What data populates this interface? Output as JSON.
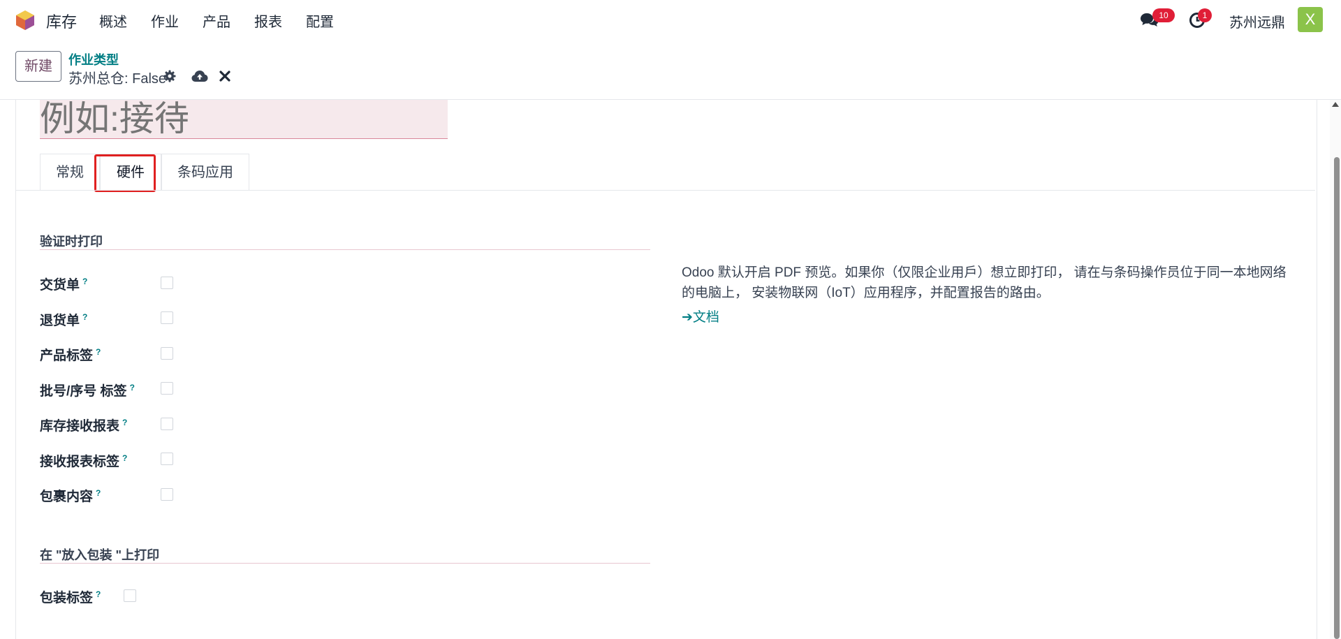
{
  "navbar": {
    "app_name": "库存",
    "menu": [
      "概述",
      "作业",
      "产品",
      "报表",
      "配置"
    ],
    "messages_badge": "10",
    "activities_badge": "1",
    "company": "苏州远鼎",
    "avatar_letter": "X",
    "icons": {
      "logo": "odoo-app-icon",
      "messages": "chat-icon",
      "activities": "clock-icon"
    }
  },
  "control": {
    "new_button": "新建",
    "breadcrumb": "作业类型",
    "record_name": "苏州总仓: False",
    "icons": {
      "settings": "gear-icon",
      "save": "cloud-upload-icon",
      "discard": "close-icon"
    }
  },
  "form": {
    "name_placeholder": "例如:接待",
    "tabs": [
      "常规",
      "硬件",
      "条码应用"
    ],
    "active_tab": "硬件",
    "section_print_on_validation": "验证时打印",
    "fields": [
      {
        "label": "交货单",
        "help": "?",
        "checked": false
      },
      {
        "label": "退货单",
        "help": "?",
        "checked": false
      },
      {
        "label": "产品标签",
        "help": "?",
        "checked": false
      },
      {
        "label": "批号/序号 标签",
        "help": "?",
        "checked": false
      },
      {
        "label": "库存接收报表",
        "help": "?",
        "checked": false
      },
      {
        "label": "接收报表标签",
        "help": "?",
        "checked": false
      },
      {
        "label": "包裹内容",
        "help": "?",
        "checked": false
      }
    ],
    "section_put_in_pack": "在 \"放入包装 \"上打印",
    "package_label": {
      "label": "包装标签",
      "help": "?",
      "checked": false
    },
    "info_text": "Odoo 默认开启 PDF 预览。如果你（仅限企业用戶）想立即打印， 请在与条码操作员位于同一本地网络的电脑上， 安装物联网（IoT）应用程序，并配置报告的路由。",
    "doc_link": "文档",
    "doc_arrow": "➔"
  },
  "colors": {
    "accent": "#017e84",
    "brand": "#714b67",
    "highlight": "#e02020",
    "badge": "#e01e37"
  }
}
